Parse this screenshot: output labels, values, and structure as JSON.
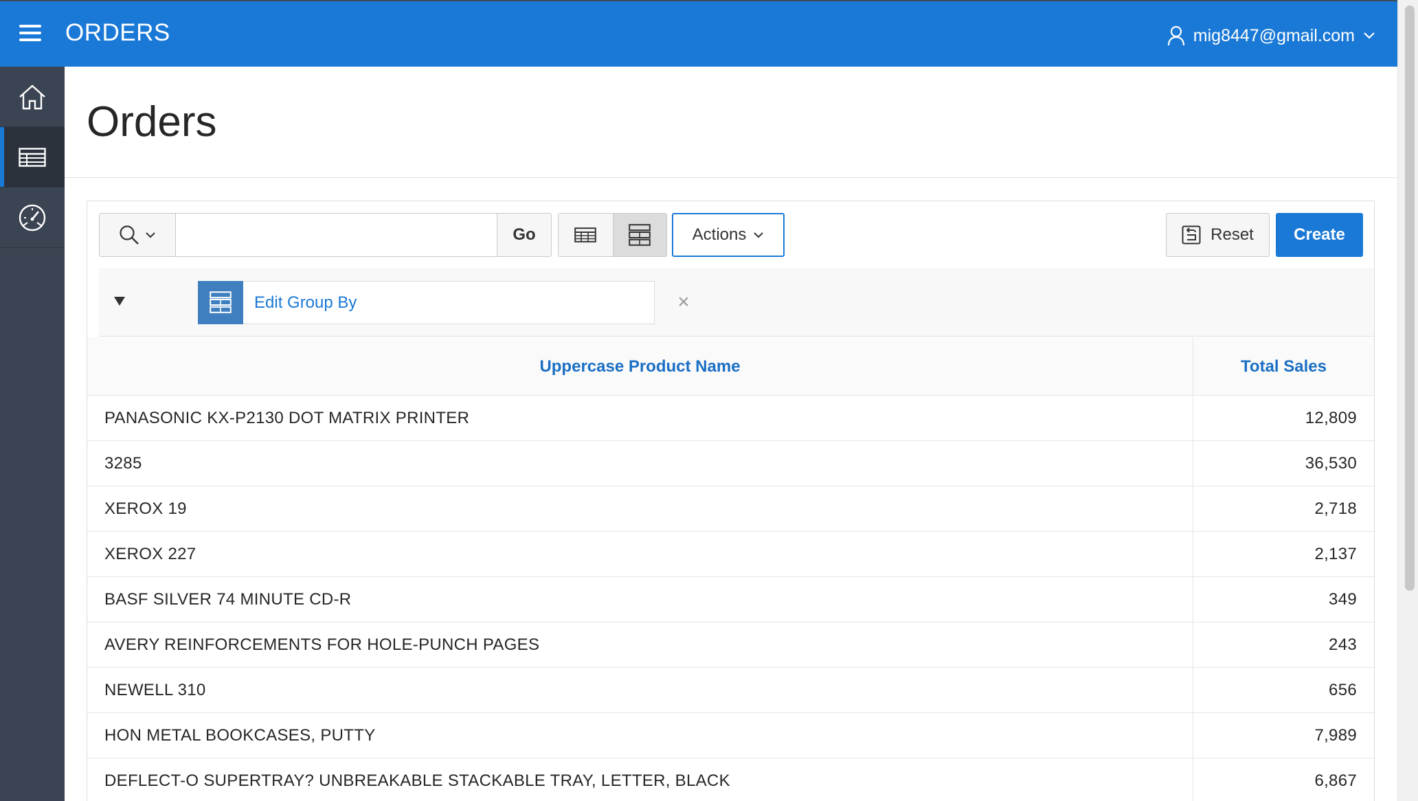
{
  "header": {
    "app_title": "ORDERS",
    "user_email": "mig8447@gmail.com",
    "accent_color": "#1a79d6"
  },
  "sidebar": {
    "items": [
      {
        "icon": "home-icon",
        "active": false
      },
      {
        "icon": "table-icon",
        "active": true
      },
      {
        "icon": "dashboard-gauge-icon",
        "active": false
      }
    ]
  },
  "page": {
    "title": "Orders"
  },
  "toolbar": {
    "search_value": "",
    "go_label": "Go",
    "actions_label": "Actions",
    "reset_label": "Reset",
    "create_label": "Create"
  },
  "group_by": {
    "label": "Edit Group By",
    "remove_symbol": "×"
  },
  "table": {
    "columns": [
      "Uppercase Product Name",
      "Total Sales"
    ],
    "rows": [
      {
        "name": "PANASONIC KX-P2130 DOT MATRIX PRINTER",
        "sales": "12,809"
      },
      {
        "name": "3285",
        "sales": "36,530"
      },
      {
        "name": "XEROX 19",
        "sales": "2,718"
      },
      {
        "name": "XEROX 227",
        "sales": "2,137"
      },
      {
        "name": "BASF SILVER 74 MINUTE CD-R",
        "sales": "349"
      },
      {
        "name": "AVERY REINFORCEMENTS FOR HOLE-PUNCH PAGES",
        "sales": "243"
      },
      {
        "name": "NEWELL 310",
        "sales": "656"
      },
      {
        "name": "HON METAL BOOKCASES, PUTTY",
        "sales": "7,989"
      },
      {
        "name": "DEFLECT-O SUPERTRAY? UNBREAKABLE STACKABLE TRAY, LETTER, BLACK",
        "sales": "6,867"
      }
    ]
  }
}
